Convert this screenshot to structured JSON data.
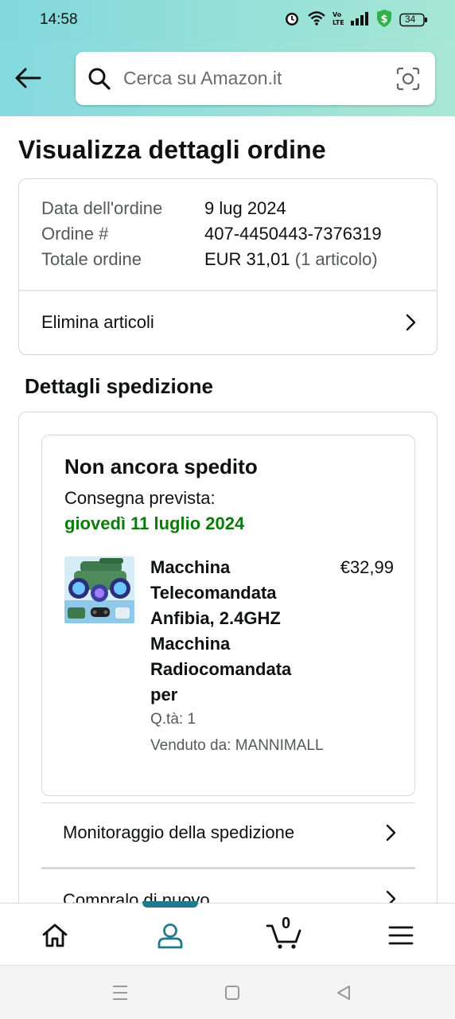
{
  "status_bar": {
    "time": "14:58",
    "battery": "34",
    "icons": [
      "alarm-icon",
      "wifi-icon",
      "volte-icon",
      "signal-icon",
      "shield-icon",
      "battery-icon"
    ]
  },
  "search": {
    "placeholder": "Cerca su Amazon.it"
  },
  "page": {
    "title": "Visualizza dettagli ordine"
  },
  "order_summary": {
    "date_label": "Data dell'ordine",
    "date_value": "9 lug 2024",
    "order_label": "Ordine #",
    "order_value": "407-4450443-7376319",
    "total_label": "Totale ordine",
    "total_value": "EUR 31,01",
    "total_items": "(1 articolo)",
    "action_label": "Elimina articoli"
  },
  "shipment": {
    "section_title": "Dettagli spedizione",
    "status": "Non ancora spedito",
    "delivery_label": "Consegna prevista:",
    "delivery_date": "giovedì 11 luglio 2024",
    "product": {
      "title_lines": [
        "Macchina",
        "Telecomandata",
        "Anfibia, 2.4GHZ",
        "Macchina",
        "Radiocomandata",
        "per"
      ],
      "price": "€32,99",
      "qty": "Q.tà: 1",
      "seller": "Venduto da: MANNIMALL"
    },
    "track_label": "Monitoraggio della spedizione",
    "buy_again_label": "Compralo di nuovo"
  },
  "bottom_nav": {
    "items": [
      "home-icon",
      "account-icon",
      "cart-icon",
      "menu-icon"
    ],
    "cart_count": "0",
    "active": "account-icon",
    "accent": "#1f7a8c"
  },
  "colors": {
    "header_gradient_start": "#84d9df",
    "header_gradient_end": "#a8e7d3",
    "delivery_green": "#0a7c0a",
    "border": "#d5d9d9"
  }
}
